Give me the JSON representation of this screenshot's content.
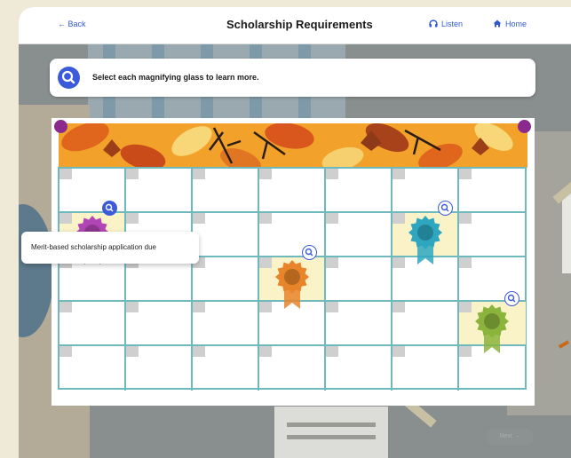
{
  "header": {
    "back_label": "← Back",
    "title": "Scholarship Requirements",
    "listen_label": "Listen",
    "home_label": "Home"
  },
  "instruction": {
    "text": "Select each magnifying glass to learn more.",
    "icon": "search-icon"
  },
  "tooltip": {
    "text": "Merit-based scholarship application due"
  },
  "calendar": {
    "rows": 5,
    "cols": 7,
    "highlighted_cells": [
      [
        1,
        0
      ],
      [
        1,
        5
      ],
      [
        2,
        3
      ],
      [
        3,
        6
      ]
    ],
    "ribbons": [
      {
        "row": 1,
        "col": 0,
        "color": "#b245b5",
        "state": "active"
      },
      {
        "row": 1,
        "col": 5,
        "color": "#2ea6bf",
        "state": "default"
      },
      {
        "row": 2,
        "col": 3,
        "color": "#e8842a",
        "state": "default"
      },
      {
        "row": 3,
        "col": 6,
        "color": "#8bb43c",
        "state": "default"
      }
    ]
  },
  "background": {
    "next_label": "Next →"
  },
  "colors": {
    "accent": "#3b5bdb",
    "grid": "#6fb9bd",
    "highlight": "#fbf3c8",
    "pin": "#8b2a8e"
  }
}
